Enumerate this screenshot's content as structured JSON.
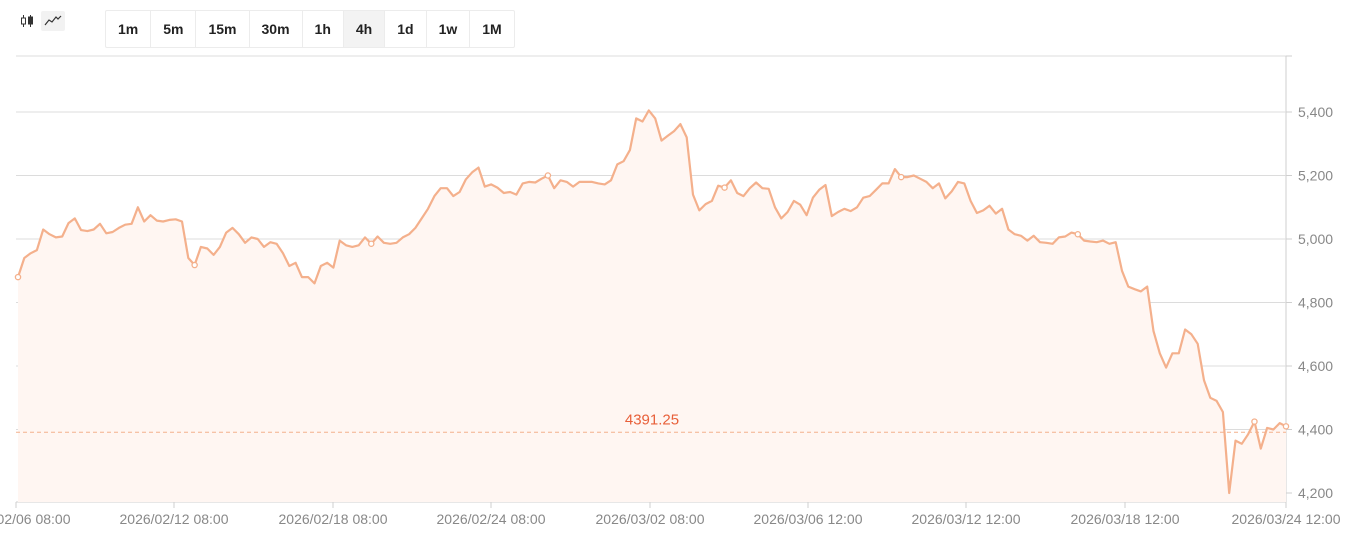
{
  "toolbar": {
    "chart_types": [
      {
        "name": "candlestick-icon",
        "active": false
      },
      {
        "name": "line-chart-icon",
        "active": true
      }
    ],
    "timeframes": [
      "1m",
      "5m",
      "15m",
      "30m",
      "1h",
      "4h",
      "1d",
      "1w",
      "1M"
    ],
    "active_timeframe": "4h"
  },
  "colors": {
    "line": "#f4b08c",
    "area": "#fff6f2",
    "current_price": "#e8603a",
    "grid": "#dcdcdc",
    "axis_text": "#888888"
  },
  "chart_data": {
    "type": "line",
    "title": "",
    "ylim": [
      4180,
      5580
    ],
    "yticks": [
      4200,
      4400,
      4600,
      4800,
      5000,
      5200,
      5400
    ],
    "ytick_labels": [
      "4,200",
      "4,400",
      "4,600",
      "4,800",
      "5,000",
      "5,200",
      "5,400"
    ],
    "xtick_labels": [
      "2026/02/06 08:00",
      "2026/02/12 08:00",
      "2026/02/18 08:00",
      "2026/02/24 08:00",
      "2026/03/02 08:00",
      "2026/03/06 12:00",
      "2026/03/12 12:00",
      "2026/03/18 12:00",
      "2026/03/24 12:00"
    ],
    "current_price": 4391.25,
    "current_price_label": "4391.25",
    "series": [
      {
        "values": [
          4880,
          4940,
          4955,
          4965,
          5030,
          5015,
          5005,
          5008,
          5050,
          5065,
          5028,
          5025,
          5030,
          5048,
          5018,
          5022,
          5035,
          5045,
          5048,
          5100,
          5055,
          5075,
          5058,
          5055,
          5060,
          5062,
          5055,
          4940,
          4918,
          4975,
          4970,
          4950,
          4975,
          5020,
          5035,
          5015,
          4988,
          5005,
          5000,
          4975,
          4990,
          4985,
          4955,
          4915,
          4925,
          4880,
          4880,
          4860,
          4915,
          4925,
          4910,
          4995,
          4980,
          4975,
          4980,
          5005,
          4985,
          5008,
          4988,
          4985,
          4988,
          5005,
          5015,
          5035,
          5065,
          5095,
          5135,
          5160,
          5160,
          5135,
          5148,
          5188,
          5210,
          5225,
          5165,
          5172,
          5162,
          5145,
          5148,
          5140,
          5175,
          5180,
          5178,
          5190,
          5200,
          5160,
          5185,
          5180,
          5165,
          5180,
          5180,
          5180,
          5175,
          5172,
          5185,
          5235,
          5245,
          5280,
          5380,
          5370,
          5405,
          5380,
          5310,
          5325,
          5340,
          5362,
          5320,
          5140,
          5090,
          5110,
          5120,
          5168,
          5162,
          5185,
          5145,
          5135,
          5160,
          5178,
          5160,
          5158,
          5100,
          5065,
          5085,
          5120,
          5108,
          5075,
          5130,
          5155,
          5170,
          5072,
          5085,
          5095,
          5088,
          5100,
          5130,
          5135,
          5155,
          5175,
          5175,
          5220,
          5195,
          5195,
          5200,
          5190,
          5180,
          5160,
          5175,
          5128,
          5150,
          5180,
          5175,
          5120,
          5082,
          5090,
          5105,
          5080,
          5095,
          5030,
          5015,
          5010,
          4995,
          5010,
          4990,
          4988,
          4985,
          5005,
          5008,
          5020,
          5015,
          4995,
          4992,
          4990,
          4995,
          4985,
          4990,
          4900,
          4850,
          4842,
          4835,
          4850,
          4710,
          4640,
          4595,
          4640,
          4640,
          4715,
          4700,
          4670,
          4555,
          4500,
          4490,
          4455,
          4200,
          4365,
          4355,
          4385,
          4425,
          4340,
          4405,
          4400,
          4420,
          4410
        ]
      }
    ]
  }
}
